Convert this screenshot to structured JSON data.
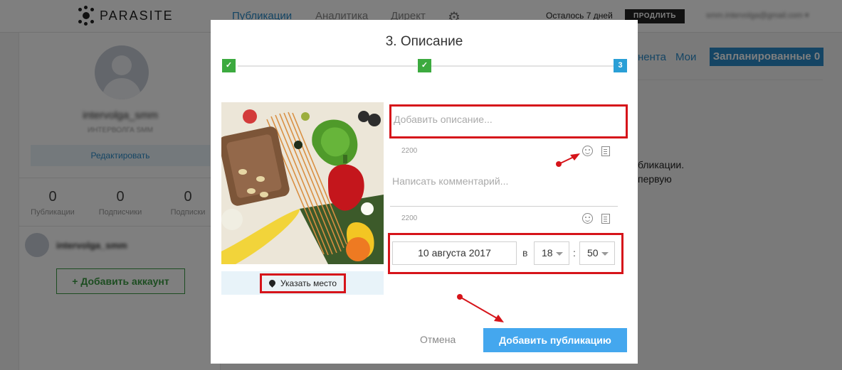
{
  "app": {
    "logo_text": "PARASITE"
  },
  "topbar": {
    "nav": [
      "Публикации",
      "Аналитика",
      "Директ"
    ],
    "trial_text": "Осталось 7 дней",
    "extend_label": "ПРОДЛИТЬ",
    "user_email": "smm.intervolga@gmail.com ▾"
  },
  "sidebar": {
    "profile_name": "intervolga_smm",
    "profile_sub": "ИНТЕРВОЛГА SMM",
    "edit_label": "Редактировать",
    "stats": [
      {
        "value": "0",
        "label": "Публикации"
      },
      {
        "value": "0",
        "label": "Подписчики"
      },
      {
        "value": "0",
        "label": "Подписки"
      }
    ],
    "account_name": "intervolga_smm",
    "add_account_label": "+ Добавить аккаунт"
  },
  "background": {
    "tab_partial": "нента",
    "tab_mine": "Мои",
    "tab_scheduled": "Запланированные 0",
    "text_line1": "бликации.",
    "text_line2": "первую"
  },
  "modal": {
    "title": "3. Описание",
    "steps": [
      {
        "label": "✓",
        "state": "done"
      },
      {
        "label": "✓",
        "state": "done"
      },
      {
        "label": "3",
        "state": "current"
      }
    ],
    "place_label": "Указать место",
    "description_placeholder": "Добавить описание...",
    "description_counter": "2200",
    "comment_placeholder": "Написать комментарий...",
    "comment_counter": "2200",
    "date_value": "10 августа 2017",
    "at_label": "в",
    "hour_value": "18",
    "colon": ":",
    "minute_value": "50",
    "cancel_label": "Отмена",
    "submit_label": "Добавить публикацию"
  },
  "colors": {
    "accent": "#2a8bc9",
    "submit": "#44a7ee",
    "step_done": "#3caa3f",
    "step_current": "#2a9fd6",
    "annotation": "#d6141a"
  }
}
